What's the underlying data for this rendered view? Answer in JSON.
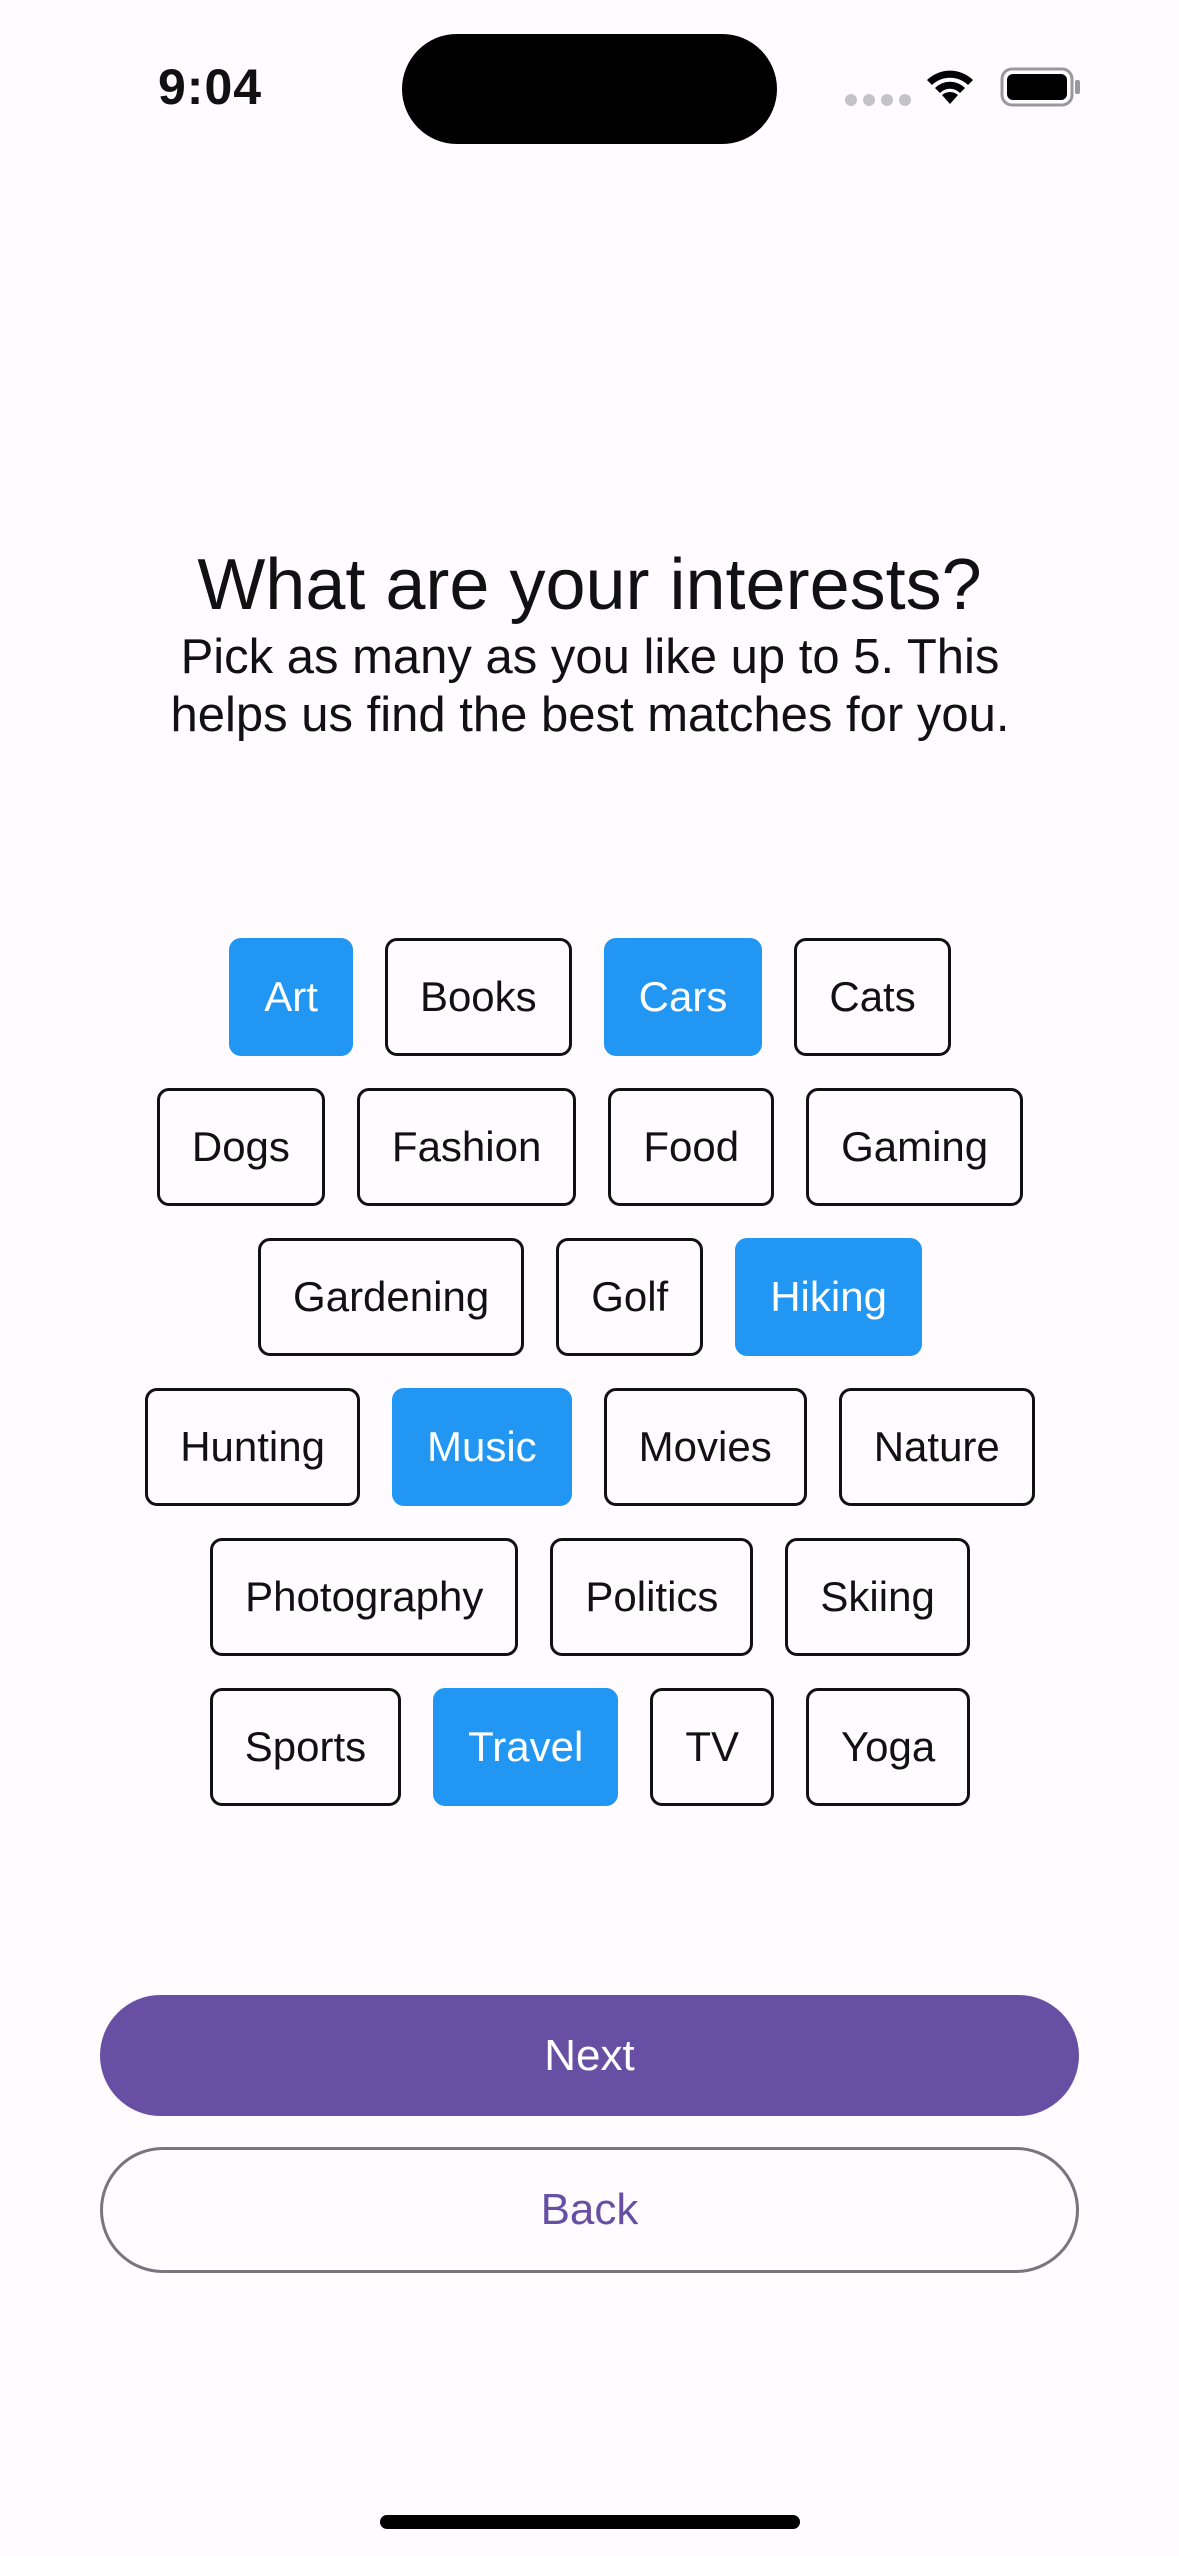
{
  "status_bar": {
    "time": "9:04",
    "icons": [
      "signal-dots-icon",
      "wifi-icon",
      "battery-icon"
    ]
  },
  "heading": "What are your interests?",
  "subheading": "Pick as many as you like up to 5. This\nhelps us find the best matches for you.",
  "chips": [
    {
      "label": "Art",
      "selected": true
    },
    {
      "label": "Books",
      "selected": false
    },
    {
      "label": "Cars",
      "selected": true
    },
    {
      "label": "Cats",
      "selected": false
    },
    {
      "label": "Dogs",
      "selected": false
    },
    {
      "label": "Fashion",
      "selected": false
    },
    {
      "label": "Food",
      "selected": false
    },
    {
      "label": "Gaming",
      "selected": false
    },
    {
      "label": "Gardening",
      "selected": false
    },
    {
      "label": "Golf",
      "selected": false
    },
    {
      "label": "Hiking",
      "selected": true
    },
    {
      "label": "Hunting",
      "selected": false
    },
    {
      "label": "Music",
      "selected": true
    },
    {
      "label": "Movies",
      "selected": false
    },
    {
      "label": "Nature",
      "selected": false
    },
    {
      "label": "Photography",
      "selected": false
    },
    {
      "label": "Politics",
      "selected": false
    },
    {
      "label": "Skiing",
      "selected": false
    },
    {
      "label": "Sports",
      "selected": false
    },
    {
      "label": "Travel",
      "selected": true
    },
    {
      "label": "TV",
      "selected": false
    },
    {
      "label": "Yoga",
      "selected": false
    }
  ],
  "buttons": {
    "next": "Next",
    "back": "Back"
  },
  "colors": {
    "background": "#fffbfe",
    "selected_chip": "#2196f3",
    "primary": "#6750a4",
    "outline": "#79747e"
  }
}
